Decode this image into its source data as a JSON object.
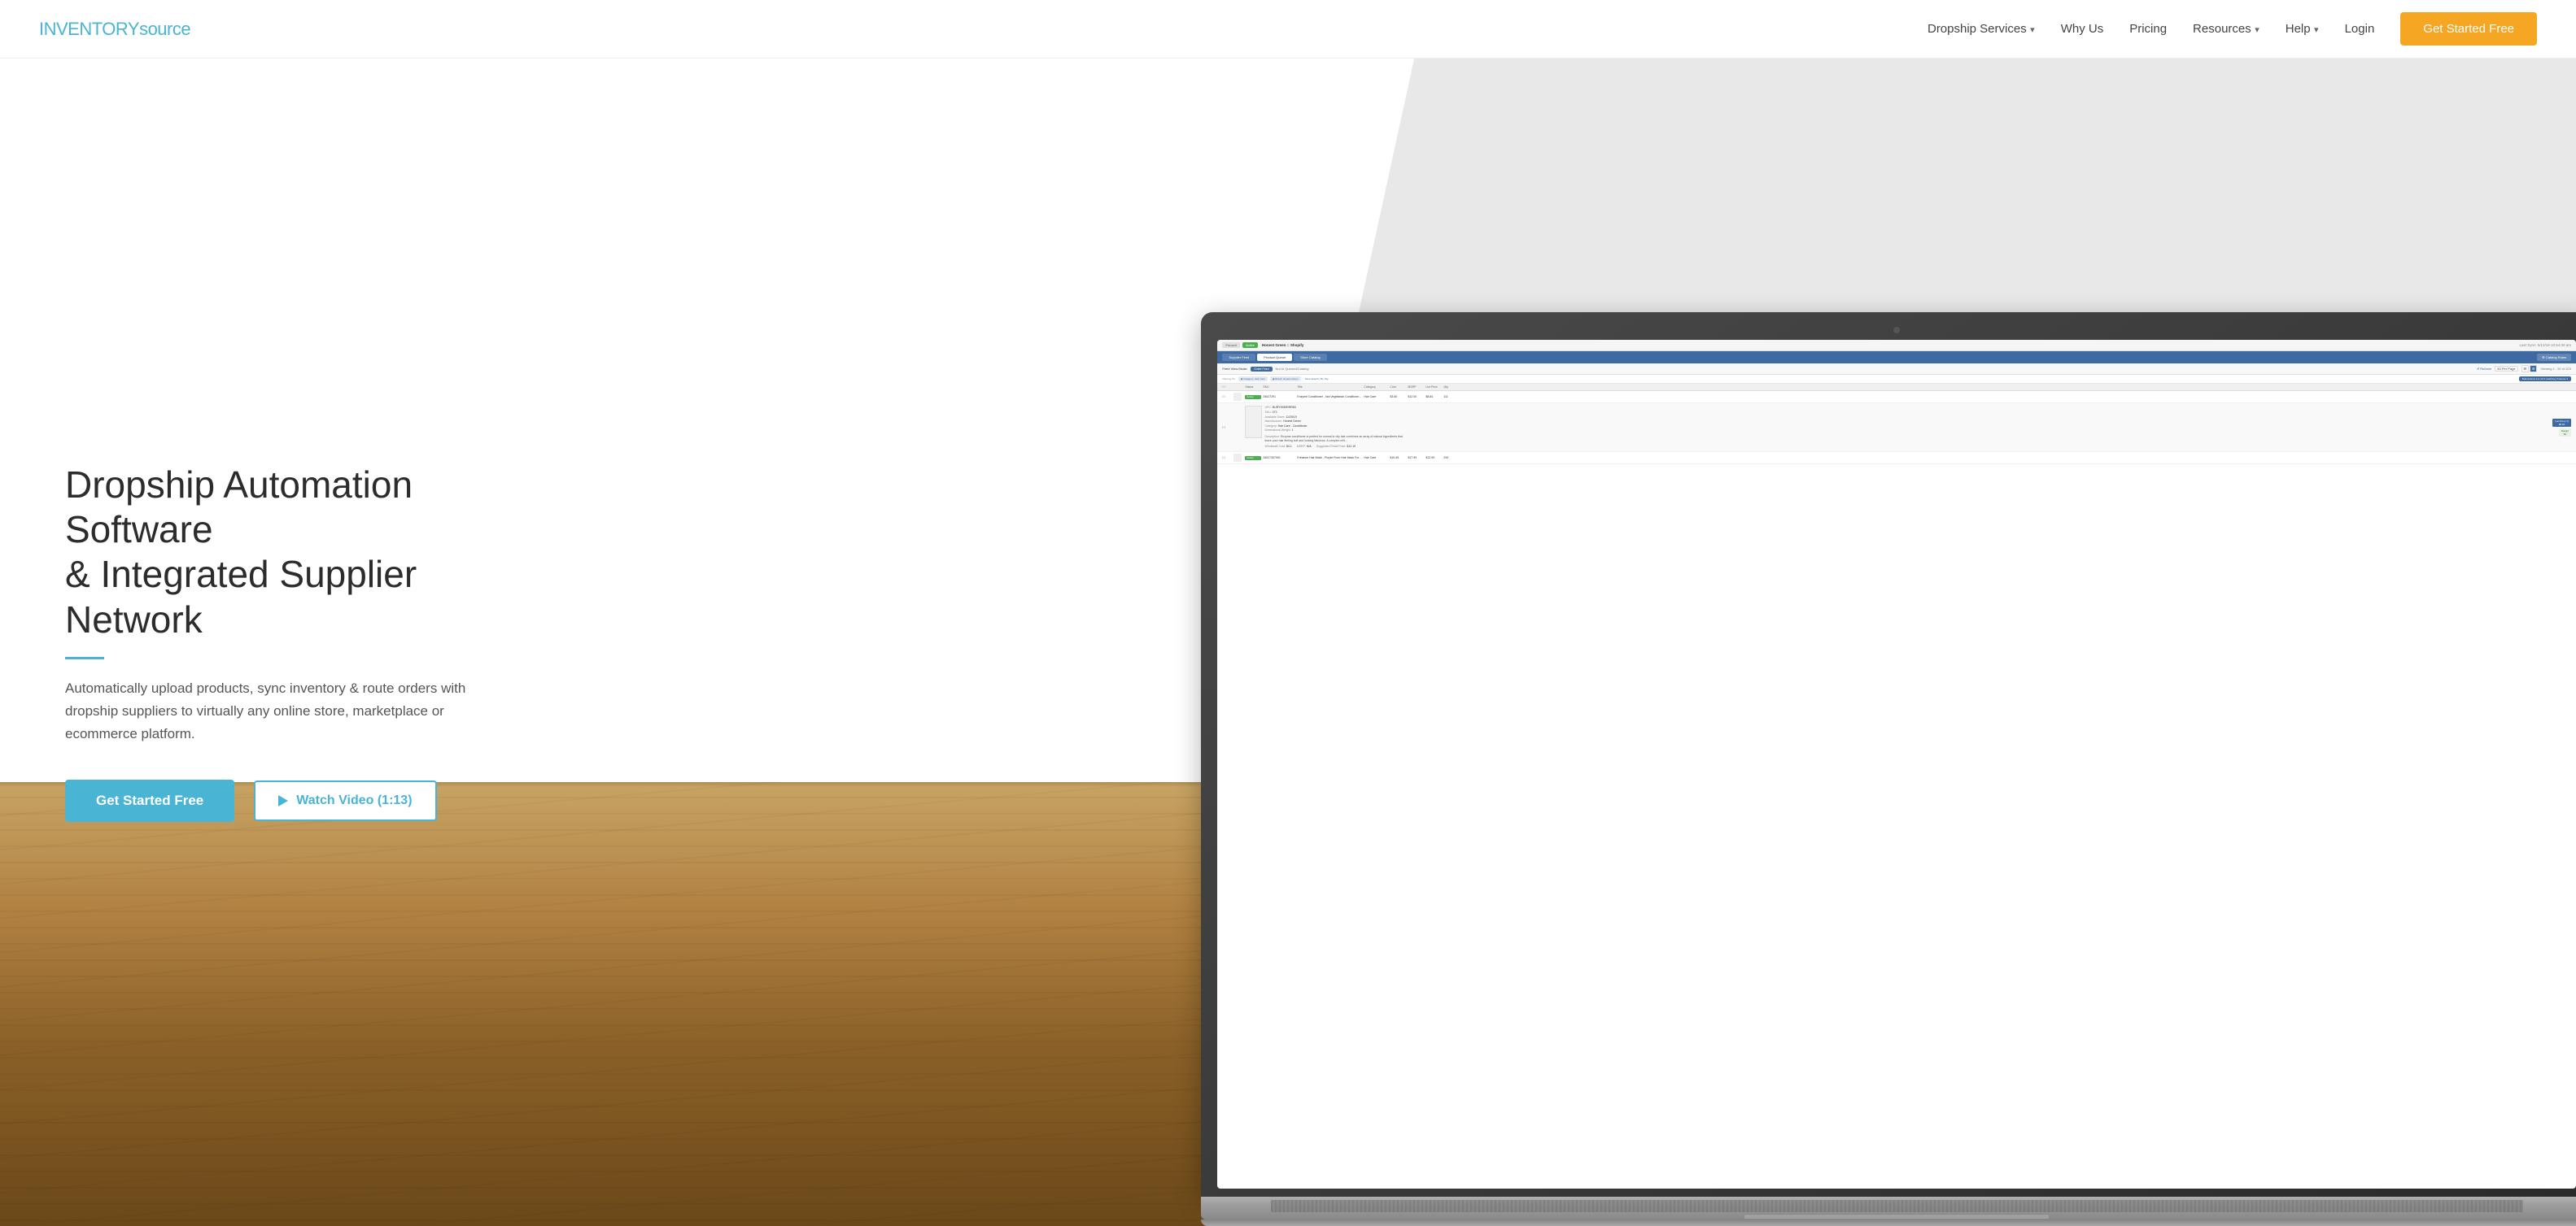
{
  "brand": {
    "name_part1": "INVENTORY",
    "name_part2": "SOUrce"
  },
  "navbar": {
    "links": [
      {
        "label": "Dropship Services",
        "has_dropdown": true,
        "id": "dropship-services"
      },
      {
        "label": "Why Us",
        "has_dropdown": false,
        "id": "why-us"
      },
      {
        "label": "Pricing",
        "has_dropdown": false,
        "id": "pricing"
      },
      {
        "label": "Resources",
        "has_dropdown": true,
        "id": "resources"
      },
      {
        "label": "Help",
        "has_dropdown": true,
        "id": "help"
      },
      {
        "label": "Login",
        "has_dropdown": false,
        "id": "login"
      }
    ],
    "cta_label": "Get Started Free"
  },
  "hero": {
    "title_line1": "Dropship Automation Software",
    "title_line2": "& Integrated Supplier Network",
    "subtitle": "Automatically upload products, sync inventory & route orders with dropship suppliers to virtually any online store, marketplace or ecommerce platform.",
    "cta_primary": "Get Started Free",
    "cta_secondary": "Watch Video (1:13)"
  },
  "screen": {
    "status_paused": "Paused",
    "status_active": "Active",
    "store_name": "Honest Green :: Shopify",
    "last_sync": "Last Sync: 5/12/18 10:54:30 am",
    "tab_supplier_feed": "Supplier Feed",
    "tab_product_queue": "Product Queue",
    "tab_store_catalog": "Store Catalog",
    "tab_catalog_rules": "⚙ Catalog Rules",
    "feed_view_label": "Feed View Mode:",
    "feed_view_entire": "Entire Feed",
    "feed_view_not_queued": "Not In Queued/Catalog",
    "search_placeholder": "Search By Keyword, SKU, or UPC",
    "refresh_btn": "↺ Refresh",
    "per_page": "50 Per Page",
    "viewing": "Viewing 1 - 50 of 623",
    "filter_label": "Filtering On:",
    "filter_chip1": "◉ Category: Hair Care",
    "filter_chip2": "◉ Brand: Honest Green",
    "save_search": "Save Search | By Tag",
    "bulk_actions_btn": "Bulk Actions For All 3 matching Products ▾",
    "col_headers": [
      "",
      "",
      "Status",
      "SKU",
      "Title",
      "Category",
      "Cost",
      "MSRP",
      "List Price",
      "Qty"
    ],
    "row1": {
      "sku": "34027291",
      "title": "Enzyme Conditioner - Not Vegetarian Conditioner For Normal To Oily Hair - Case Of 1 - 11.6 Oz",
      "category": "Hair Care",
      "cost": "$3.60",
      "msrp": "$12.00",
      "list_price": "$8.84",
      "qty": "111"
    },
    "row2_expanded": {
      "upc": "BURY3939RRR83",
      "sku_val": "372",
      "available_since": "11/25/19",
      "manufacturer": "Honest Green",
      "category": "Hair Care - Conditioner",
      "dimensional_weight": "1",
      "description": "Enzyme conditioner is perfect for normal to oily hair combines an array of natural ingredients that leave your hair feeling soft and looking fabulous. A complex milt...",
      "wholesale_cost": "$4.1",
      "msrp_val": "N/A",
      "suggested_retail": "$12.19",
      "list_price_btn": "List Price (7)\n$8.84",
      "margin_btn": "Margin\n$4"
    },
    "row3": {
      "sku": "34027307091",
      "title": "Enhance Hair Mask - Purple From Hair Mask For Colored And Brasy Dry Hair - Case Of 1 - 11.6 Oz",
      "category": "Hair Care",
      "cost": "$10.45",
      "msrp": "$17.99",
      "list_price": "$12.99",
      "qty": "200"
    }
  },
  "colors": {
    "accent_blue": "#4ab4d4",
    "cta_orange": "#f5a623",
    "nav_text": "#444444",
    "hero_text": "#2c2c2c",
    "subtitle_text": "#555555"
  }
}
